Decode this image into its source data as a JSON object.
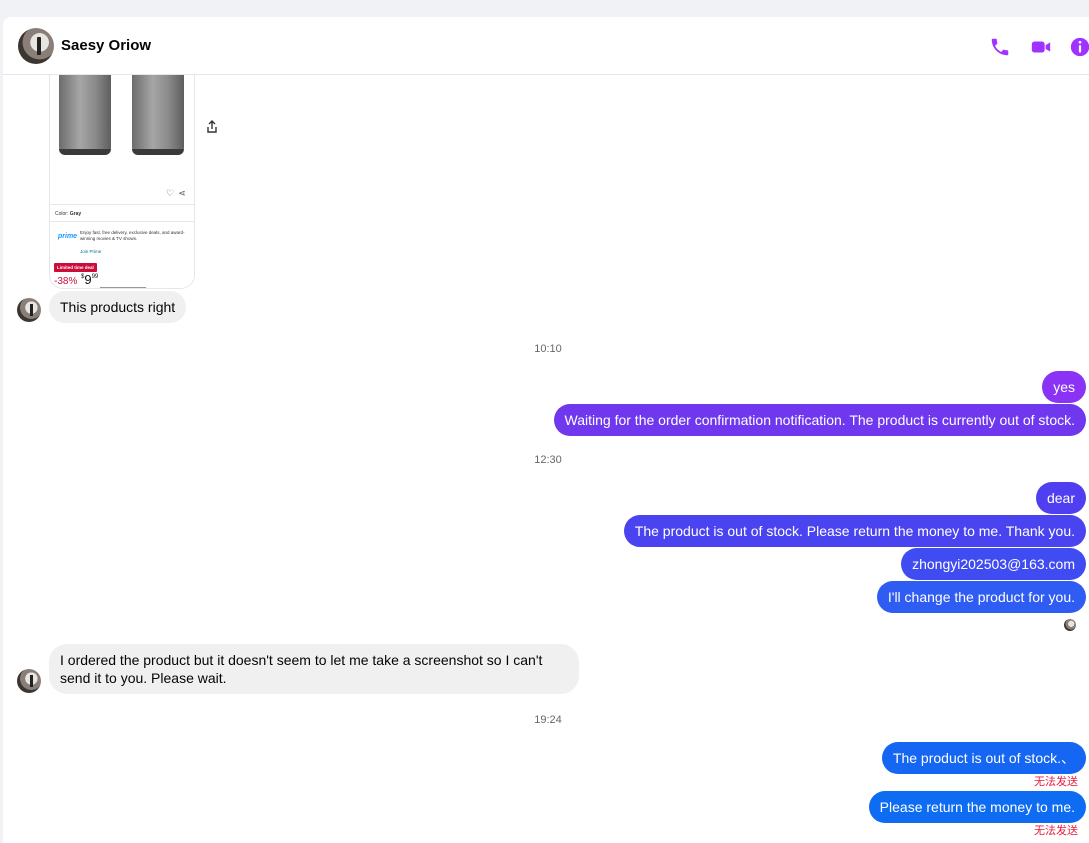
{
  "header": {
    "contact_name": "Saesy Oriow",
    "icons": [
      "phone-icon",
      "video-camera-icon",
      "info-icon"
    ],
    "accent_color": "#a033ff"
  },
  "product_card": {
    "color_label": "Color:",
    "color_value": "Gray",
    "prime_logo": "prime",
    "prime_text": "Enjoy fast, free delivery, exclusive deals, and award-winning movies & TV shows.",
    "prime_join": "Join Prime",
    "deal_badge": "Limited time deal",
    "discount": "-38%",
    "price_dollar": "$",
    "price_whole": "9",
    "price_cents": "99"
  },
  "messages": [
    {
      "id": "m1",
      "text": "This products right"
    },
    {
      "id": "ts1",
      "text": "10:10"
    },
    {
      "id": "m2",
      "text": "yes"
    },
    {
      "id": "m3",
      "text": "Waiting for the order confirmation notification. The product is currently out of stock."
    },
    {
      "id": "ts2",
      "text": "12:30"
    },
    {
      "id": "m4",
      "text": "dear"
    },
    {
      "id": "m5",
      "text": "The product is out of stock. Please return the money to me. Thank you."
    },
    {
      "id": "m6",
      "text": "zhongyi202503@163.com"
    },
    {
      "id": "m7",
      "text": "I'll change the product for you."
    },
    {
      "id": "m8",
      "text": "I ordered the product but it doesn't seem to let me take a screenshot so I can't send it to you. Please wait."
    },
    {
      "id": "ts3",
      "text": "19:24"
    },
    {
      "id": "m9",
      "text": "The product is out of stock.、",
      "status": "无法发送"
    },
    {
      "id": "m10",
      "text": "Please return the money to me.",
      "status": "无法发送"
    }
  ]
}
